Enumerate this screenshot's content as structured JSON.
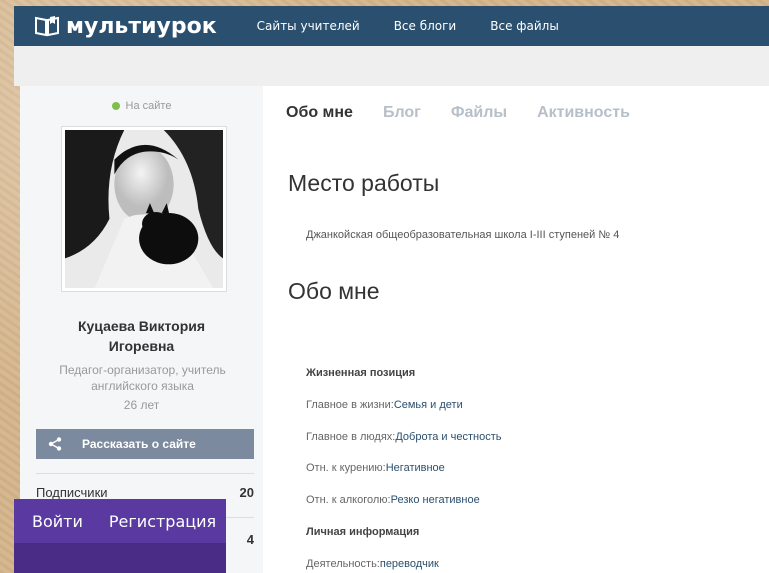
{
  "brand": {
    "name": "мультиурок"
  },
  "nav": [
    "Сайты учителей",
    "Все блоги",
    "Все файлы"
  ],
  "profile": {
    "status": "На сайте",
    "name_line1": "Куцаева Виктория",
    "name_line2": "Игоревна",
    "role_line1": "Педагог-организатор, учитель",
    "role_line2": "английского языка",
    "age": "26 лет",
    "share_label": "Рассказать о сайте",
    "stats": [
      {
        "label": "Подписчики",
        "value": "20"
      },
      {
        "label": "",
        "value": "4"
      }
    ]
  },
  "overlay": {
    "login": "Войти",
    "register": "Регистрация"
  },
  "tabs": [
    "Обо мне",
    "Блог",
    "Файлы",
    "Активность"
  ],
  "main": {
    "work_title": "Место работы",
    "work_value": "Джанкойская общеобразовательная школа I-III ступеней № 4",
    "about_title": "Обо мне",
    "life_section": "Жизненная позиция",
    "rows": [
      {
        "label": "Главное в жизни:",
        "value": "Семья и дети"
      },
      {
        "label": "Главное в людях:",
        "value": "Доброта и честность"
      },
      {
        "label": "Отн. к курению:",
        "value": "Негативное"
      },
      {
        "label": "Отн. к алкоголю:",
        "value": "Резко негативное"
      }
    ],
    "personal_section": "Личная информация",
    "activity": {
      "label": "Деятельность:",
      "value": "переводчик"
    }
  },
  "colors": {
    "topbar": "#2b4f6e",
    "online": "#7cc04a",
    "share": "#7b8a9e",
    "overlay": "#5a3aa0"
  }
}
